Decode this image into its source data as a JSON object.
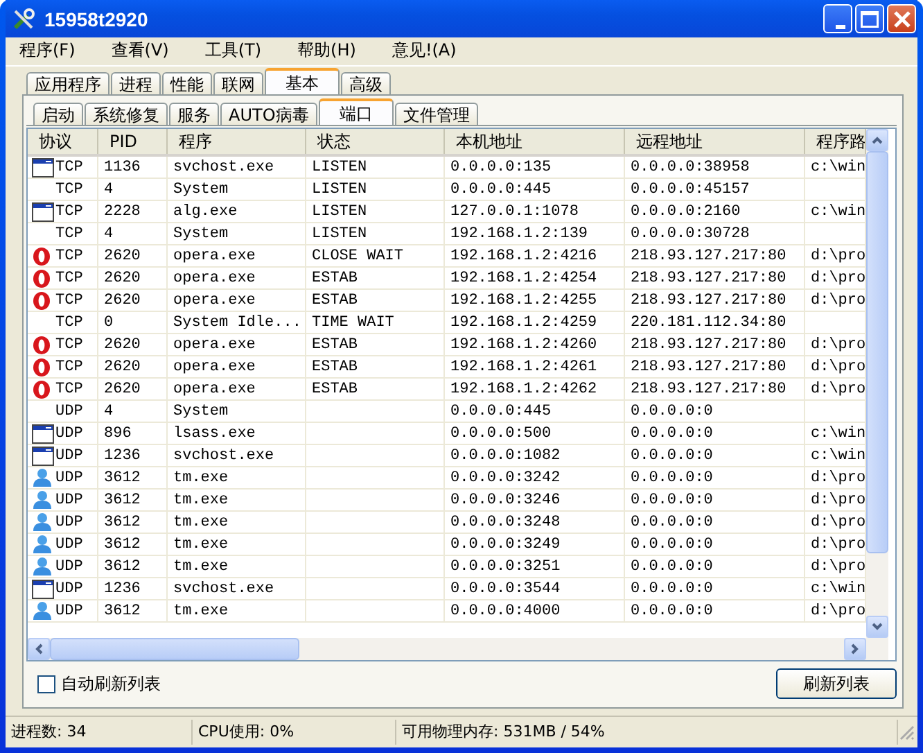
{
  "window": {
    "title": "15958t2920"
  },
  "menu": [
    "程序(F)",
    "查看(V)",
    "工具(T)",
    "帮助(H)",
    "意见!(A)"
  ],
  "tabs": [
    {
      "label": "应用程序",
      "selected": false
    },
    {
      "label": "进程",
      "selected": false
    },
    {
      "label": "性能",
      "selected": false
    },
    {
      "label": "联网",
      "selected": false
    },
    {
      "label": "基本",
      "selected": true
    },
    {
      "label": "高级",
      "selected": false
    }
  ],
  "subtabs": [
    {
      "label": "启动",
      "selected": false
    },
    {
      "label": "系统修复",
      "selected": false
    },
    {
      "label": "服务",
      "selected": false
    },
    {
      "label": "AUTO病毒",
      "selected": false
    },
    {
      "label": "端口",
      "selected": true
    },
    {
      "label": "文件管理",
      "selected": false
    }
  ],
  "table": {
    "columns": [
      "协议",
      "PID",
      "程序",
      "状态",
      "本机地址",
      "远程地址",
      "程序路"
    ],
    "rows": [
      {
        "kind": "window",
        "cells": [
          "TCP",
          "1136",
          "svchost.exe",
          "LISTEN",
          "0.0.0.0:135",
          "0.0.0.0:38958",
          "c:\\win"
        ]
      },
      {
        "kind": "none",
        "cells": [
          "TCP",
          "4",
          "System",
          "LISTEN",
          "0.0.0.0:445",
          "0.0.0.0:45157",
          ""
        ]
      },
      {
        "kind": "window",
        "cells": [
          "TCP",
          "2228",
          "alg.exe",
          "LISTEN",
          "127.0.0.1:1078",
          "0.0.0.0:2160",
          "c:\\win"
        ]
      },
      {
        "kind": "none",
        "cells": [
          "TCP",
          "4",
          "System",
          "LISTEN",
          "192.168.1.2:139",
          "0.0.0.0:30728",
          ""
        ]
      },
      {
        "kind": "opera",
        "cells": [
          "TCP",
          "2620",
          "opera.exe",
          "CLOSE WAIT",
          "192.168.1.2:4216",
          "218.93.127.217:80",
          "d:\\pro"
        ]
      },
      {
        "kind": "opera",
        "cells": [
          "TCP",
          "2620",
          "opera.exe",
          "ESTAB",
          "192.168.1.2:4254",
          "218.93.127.217:80",
          "d:\\pro"
        ]
      },
      {
        "kind": "opera",
        "cells": [
          "TCP",
          "2620",
          "opera.exe",
          "ESTAB",
          "192.168.1.2:4255",
          "218.93.127.217:80",
          "d:\\pro"
        ]
      },
      {
        "kind": "none",
        "cells": [
          "TCP",
          "0",
          "System Idle...",
          "TIME WAIT",
          "192.168.1.2:4259",
          "220.181.112.34:80",
          ""
        ]
      },
      {
        "kind": "opera",
        "cells": [
          "TCP",
          "2620",
          "opera.exe",
          "ESTAB",
          "192.168.1.2:4260",
          "218.93.127.217:80",
          "d:\\pro"
        ]
      },
      {
        "kind": "opera",
        "cells": [
          "TCP",
          "2620",
          "opera.exe",
          "ESTAB",
          "192.168.1.2:4261",
          "218.93.127.217:80",
          "d:\\pro"
        ]
      },
      {
        "kind": "opera",
        "cells": [
          "TCP",
          "2620",
          "opera.exe",
          "ESTAB",
          "192.168.1.2:4262",
          "218.93.127.217:80",
          "d:\\pro"
        ]
      },
      {
        "kind": "none",
        "cells": [
          "UDP",
          "4",
          "System",
          "",
          "0.0.0.0:445",
          "0.0.0.0:0",
          ""
        ]
      },
      {
        "kind": "window",
        "cells": [
          "UDP",
          "896",
          "lsass.exe",
          "",
          "0.0.0.0:500",
          "0.0.0.0:0",
          "c:\\win"
        ]
      },
      {
        "kind": "window",
        "cells": [
          "UDP",
          "1236",
          "svchost.exe",
          "",
          "0.0.0.0:1082",
          "0.0.0.0:0",
          "c:\\win"
        ]
      },
      {
        "kind": "person",
        "cells": [
          "UDP",
          "3612",
          "tm.exe",
          "",
          "0.0.0.0:3242",
          "0.0.0.0:0",
          "d:\\pro"
        ]
      },
      {
        "kind": "person",
        "cells": [
          "UDP",
          "3612",
          "tm.exe",
          "",
          "0.0.0.0:3246",
          "0.0.0.0:0",
          "d:\\pro"
        ]
      },
      {
        "kind": "person",
        "cells": [
          "UDP",
          "3612",
          "tm.exe",
          "",
          "0.0.0.0:3248",
          "0.0.0.0:0",
          "d:\\pro"
        ]
      },
      {
        "kind": "person",
        "cells": [
          "UDP",
          "3612",
          "tm.exe",
          "",
          "0.0.0.0:3249",
          "0.0.0.0:0",
          "d:\\pro"
        ]
      },
      {
        "kind": "person",
        "cells": [
          "UDP",
          "3612",
          "tm.exe",
          "",
          "0.0.0.0:3251",
          "0.0.0.0:0",
          "d:\\pro"
        ]
      },
      {
        "kind": "window",
        "cells": [
          "UDP",
          "1236",
          "svchost.exe",
          "",
          "0.0.0.0:3544",
          "0.0.0.0:0",
          "c:\\win"
        ]
      },
      {
        "kind": "person",
        "cells": [
          "UDP",
          "3612",
          "tm.exe",
          "",
          "0.0.0.0:4000",
          "0.0.0.0:0",
          "d:\\pro"
        ]
      }
    ]
  },
  "auto_refresh": {
    "label": "自动刷新列表",
    "checked": false
  },
  "refresh_button": "刷新列表",
  "status_bar": [
    "进程数: 34",
    "CPU使用: 0%",
    "可用物理内存: 531MB / 54%"
  ]
}
